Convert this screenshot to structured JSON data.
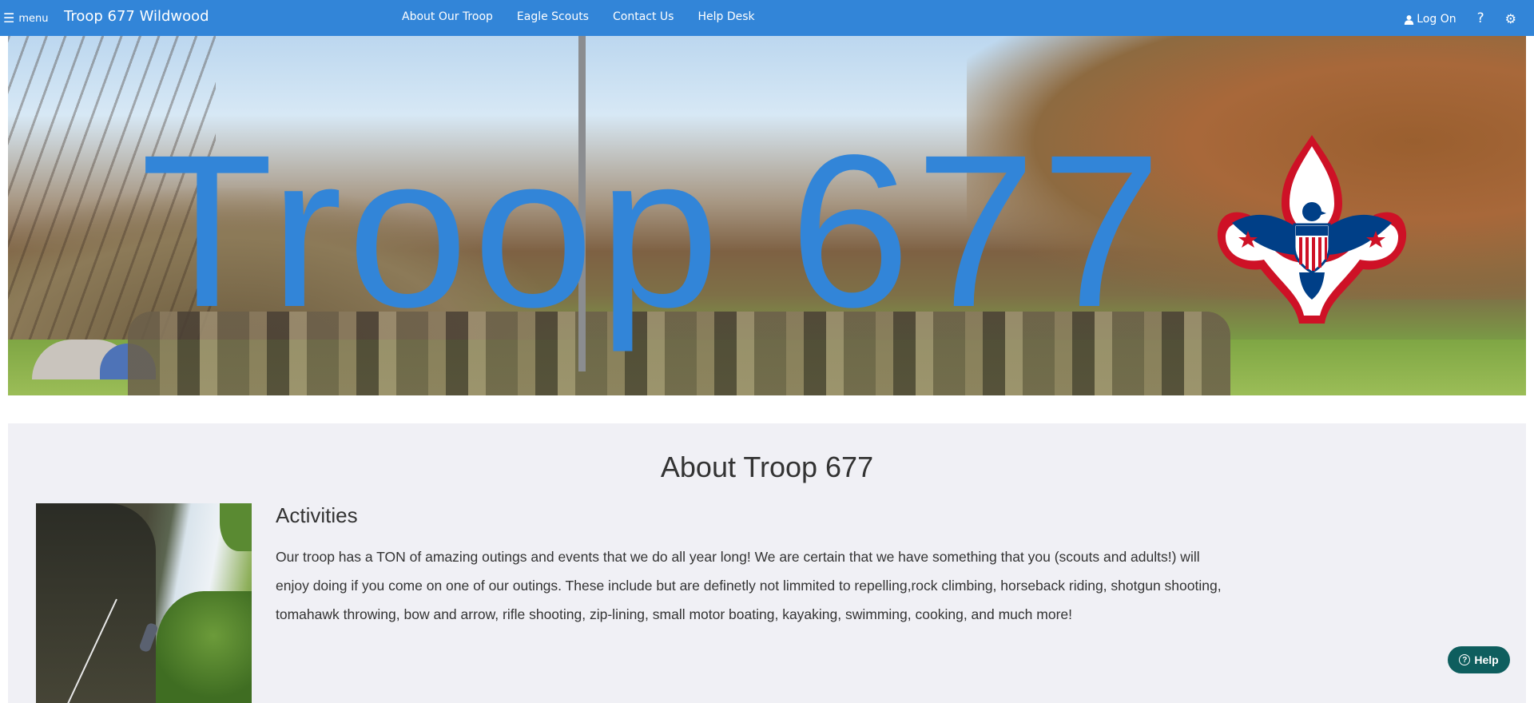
{
  "nav": {
    "menu_label": "menu",
    "site_title": "Troop 677 Wildwood",
    "links": [
      "About Our Troop",
      "Eagle Scouts",
      "Contact Us",
      "Help Desk"
    ],
    "logon_label": "Log On",
    "help_label": "?",
    "bg_color": "#3285d8"
  },
  "hero": {
    "title": "Troop 677",
    "title_color": "#3285d8",
    "emblem": "scouts-bsa-fleur-de-lis-emblem"
  },
  "about": {
    "heading": "About Troop 677",
    "activities": {
      "title": "Activities",
      "body": "Our troop has a TON of amazing outings and events that we do all year long! We are certain that we have something that you (scouts and adults!) will enjoy doing if you come on one of our outings. These include but are definetly not limmited to repelling,rock climbing, horseback riding, shotgun shooting, tomahawk throwing, bow and arrow, rifle shooting, zip-lining, small motor boating, kayaking, swimming, cooking, and much more!",
      "image": "rock-climbing-photo"
    }
  },
  "help_button": {
    "label": "Help",
    "color": "#0e5e5e"
  }
}
